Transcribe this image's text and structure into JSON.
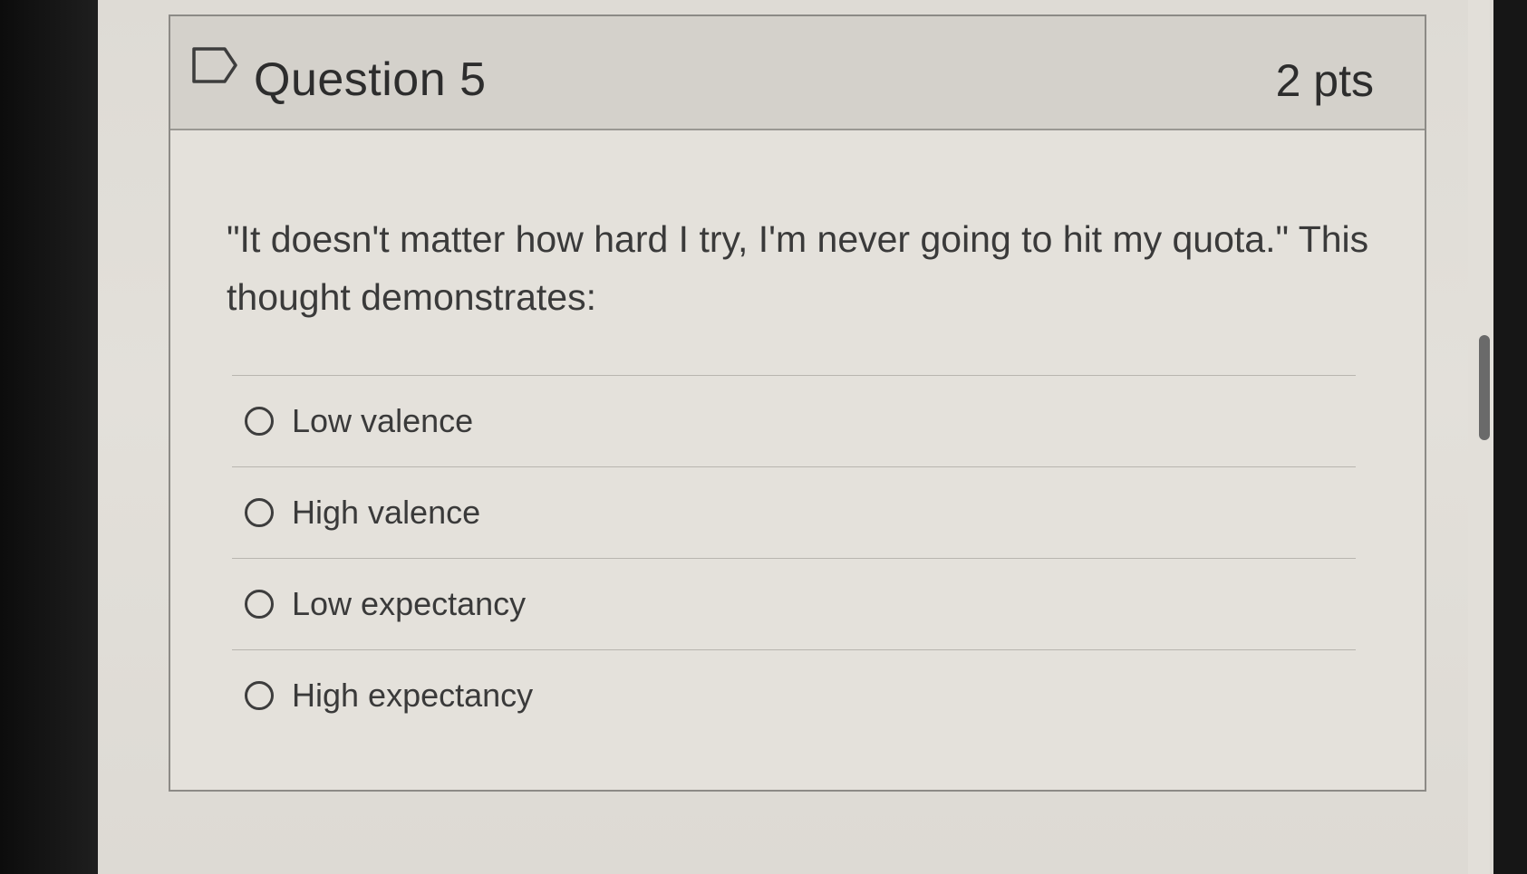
{
  "question": {
    "title": "Question 5",
    "points": "2 pts",
    "text": "\"It doesn't matter how hard I try, I'm never going to hit my quota.\" This thought demonstrates:",
    "flag_icon": "flag-icon",
    "answers": [
      {
        "label": "Low valence"
      },
      {
        "label": "High valence"
      },
      {
        "label": "Low expectancy"
      },
      {
        "label": "High expectancy"
      }
    ]
  }
}
